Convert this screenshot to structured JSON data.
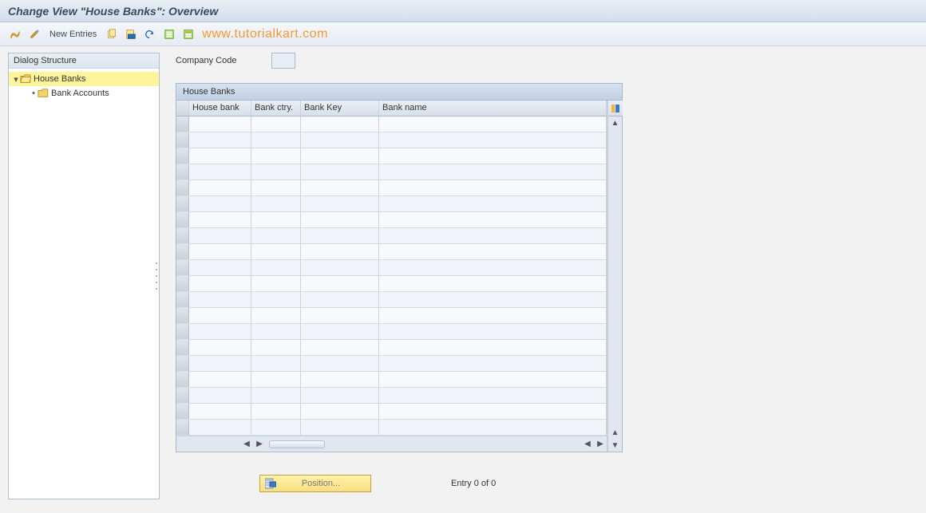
{
  "title": "Change View \"House Banks\": Overview",
  "toolbar": {
    "new_entries": "New Entries"
  },
  "watermark": "www.tutorialkart.com",
  "sidebar": {
    "header": "Dialog Structure",
    "items": [
      {
        "label": "House Banks",
        "selected": true,
        "open": true
      },
      {
        "label": "Bank Accounts",
        "selected": false
      }
    ]
  },
  "company_code": {
    "label": "Company Code",
    "value": ""
  },
  "panel": {
    "title": "House Banks",
    "columns": {
      "house_bank": "House bank",
      "bank_ctry": "Bank ctry.",
      "bank_key": "Bank Key",
      "bank_name": "Bank name"
    },
    "rows": 20
  },
  "footer": {
    "position_label": "Position...",
    "entry_text": "Entry 0 of 0"
  }
}
